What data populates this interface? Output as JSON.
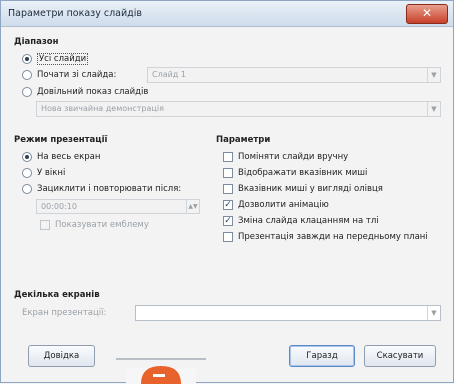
{
  "dialog": {
    "title": "Параметри показу слайдів",
    "close_glyph": "✕"
  },
  "range": {
    "heading": "Діапазон",
    "all_slides": "Усі слайди",
    "from_slide": "Почати зі слайда:",
    "from_slide_value": "Слайд 1",
    "custom_show": "Довільний показ слайдів",
    "custom_show_value": "Нова звичайна демонстрація"
  },
  "mode": {
    "heading": "Режим презентації",
    "full_screen": "На весь екран",
    "in_window": "У вікні",
    "loop_restart": "Зациклити і повторювати після:",
    "loop_time": "00:00:10",
    "show_logo": "Показувати емблему"
  },
  "options": {
    "heading": "Параметри",
    "items": [
      {
        "label": "Поміняти слайди вручну",
        "checked": false
      },
      {
        "label": "Відображати вказівник миші",
        "checked": false
      },
      {
        "label": "Вказівник миші у вигляді олівця",
        "checked": false
      },
      {
        "label": "Дозволити анімацію",
        "checked": true
      },
      {
        "label": "Зміна слайда клацанням на тлі",
        "checked": true
      },
      {
        "label": "Презентація завжди на передньому плані",
        "checked": false
      }
    ]
  },
  "multi_display": {
    "heading": "Декілька екранів",
    "label": "Екран презентації:",
    "value": ""
  },
  "buttons": {
    "help": "Довідка",
    "ok": "Гаразд",
    "cancel": "Скасувати"
  },
  "colors": {
    "accent": "#5b88c7",
    "deco_orange": "#e8632b"
  }
}
